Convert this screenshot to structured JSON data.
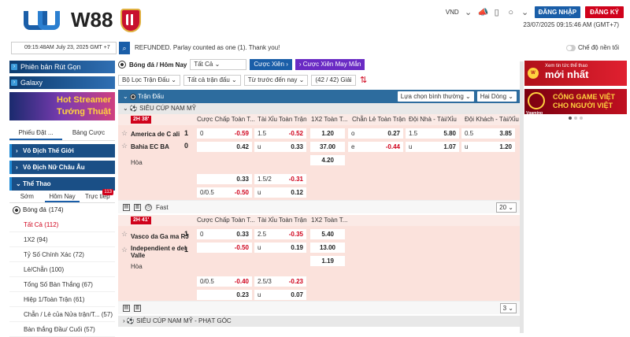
{
  "header": {
    "brand": "W88",
    "currency": "VND",
    "login": "ĐĂNG NHẬP",
    "register": "ĐĂNG KÝ",
    "datetime": "23/07/2025 09:15:46 AM (GMT+7)"
  },
  "topbar": {
    "time": "09:15:48AM July 23, 2025 GMT +7",
    "message": "REFUNDED. Parlay counted as one (1). Thank you!",
    "no_bg": "Chế độ nền tối"
  },
  "sidebar": {
    "promo1": "Phiên bản Rút Gọn",
    "promo2": "Galaxy",
    "hot_line1": "Hot Streamer",
    "hot_line2": "Tướng Thuật",
    "tab_bet": "Phiếu Đặt ...",
    "tab_board": "Bảng Cược",
    "sec1": "Vô Địch Thế Giới",
    "sec2": "Vô Địch Nữ Châu Âu",
    "sec3": "Thể Thao",
    "sub_early": "Sớm",
    "sub_today": "Hôm Nay",
    "sub_live": "Trực tiếp",
    "live_count": "113",
    "sport": "Bóng đá",
    "sport_count": "(174)",
    "items": [
      {
        "label": "Tất Cả",
        "count": "(112)"
      },
      {
        "label": "1X2",
        "count": "(94)"
      },
      {
        "label": "Tỷ Số Chính Xác",
        "count": "(72)"
      },
      {
        "label": "Lẻ/Chẵn",
        "count": "(100)"
      },
      {
        "label": "Tổng Số Bàn Thắng",
        "count": "(67)"
      },
      {
        "label": "Hiệp 1/Toàn Trận",
        "count": "(61)"
      },
      {
        "label": "Chẵn / Lẻ của Nửa trận/T...",
        "count": "(57)"
      },
      {
        "label": "Bàn thắng Đầu/ Cuối",
        "count": "(57)"
      }
    ]
  },
  "main": {
    "breadcrumb": "Bóng đá / Hôm Nay",
    "sel_all": "Tất Cả",
    "btn_parlay": "Cược Xiên",
    "btn_lucky": "Cược Xiên May Mắn",
    "filter_league": "Bộ Lọc Trận Đấu",
    "filter_all": "Tất cả trận đấu",
    "filter_time": "Từ trước đến nay",
    "league_count": "(42 / 42) Giải",
    "grid_title": "Trận Đấu",
    "sel_normal": "Lựa chọn bình thường",
    "sel_two": "Hai Dòng",
    "columns": [
      "Cược Chấp Toàn T...",
      "Tài Xỉu Toàn Trận",
      "1X2 Toàn T...",
      "Chẵn Lẻ Toàn Trận",
      "Đội Nhà - Tài/Xỉu",
      "Đội Khách - Tài/Xỉu"
    ],
    "league1": "SIÊU CÚP NAM MỸ",
    "league2": "SIÊU CÚP NAM MỸ - PHẠT GÓC",
    "fast": "Fast",
    "draw": "Hòa",
    "matches": [
      {
        "live": "2H 38'",
        "home": "America de C ali",
        "away": "Bahia EC BA",
        "home_score": "1",
        "away_score": "0",
        "hdp": [
          [
            "0",
            "-0.59"
          ],
          [
            "",
            "0.42"
          ],
          [
            "",
            "0.33"
          ],
          [
            "0/0.5",
            "-0.50"
          ]
        ],
        "ou": [
          [
            "1.5",
            "-0.52"
          ],
          [
            "u",
            "0.33"
          ],
          [
            "1.5/2",
            "-0.31"
          ],
          [
            "u",
            "0.12"
          ]
        ],
        "x12": [
          "1.20",
          "37.00",
          "4.20"
        ],
        "oe": [
          [
            "o",
            "0.27"
          ],
          [
            "e",
            "-0.44"
          ]
        ],
        "home_ou": [
          [
            "1.5",
            "5.80"
          ],
          [
            "u",
            "1.07"
          ]
        ],
        "away_ou": [
          [
            "0.5",
            "3.85"
          ],
          [
            "u",
            "1.20"
          ]
        ],
        "more": "20"
      },
      {
        "live": "2H 41'",
        "home": "Vasco da Ga ma RJ",
        "away": "Independient e del Valle",
        "home_score": "1",
        "away_score": "1",
        "hdp": [
          [
            "0",
            "0.33"
          ],
          [
            "",
            "-0.50"
          ],
          [
            "0/0.5",
            "-0.40"
          ],
          [
            "",
            "0.23"
          ]
        ],
        "ou": [
          [
            "2.5",
            "-0.35"
          ],
          [
            "u",
            "0.19"
          ],
          [
            "2.5/3",
            "-0.23"
          ],
          [
            "u",
            "0.07"
          ]
        ],
        "x12": [
          "5.40",
          "13.00",
          "1.19"
        ],
        "more": "3"
      }
    ]
  },
  "banners": {
    "b1_small": "Xem tin tức thể thao",
    "b1_big": "mới nhất",
    "b1_logo": "W",
    "b2_line1": "CỔNG GAME VIỆT",
    "b2_line2": "CHO NGƯỜI VIỆT",
    "b2_brand": "Vgaming"
  }
}
